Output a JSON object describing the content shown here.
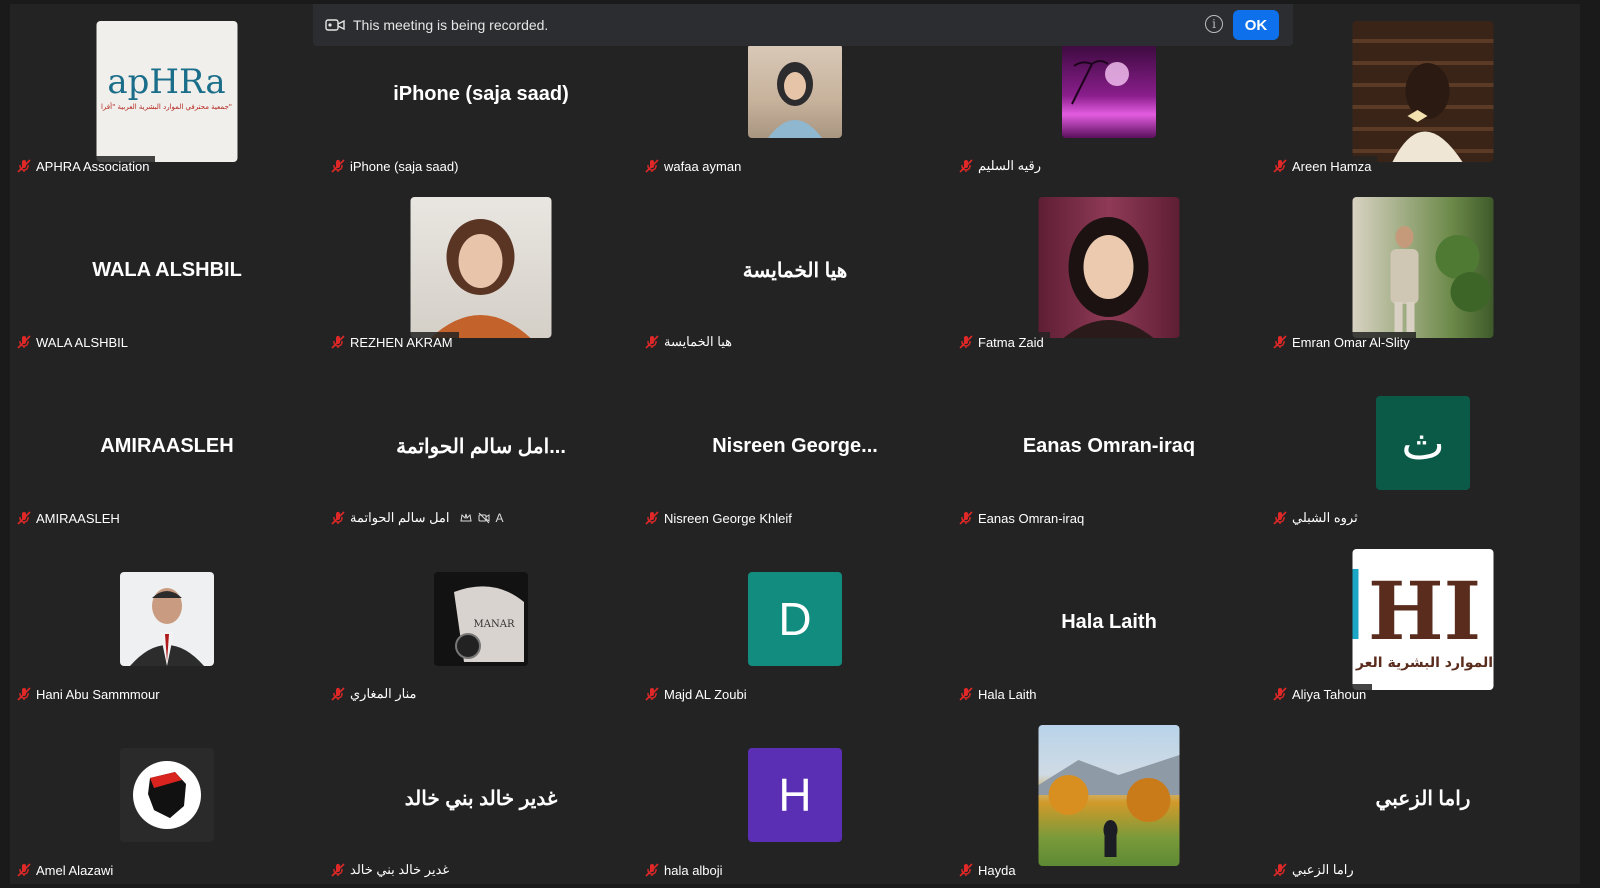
{
  "banner": {
    "text": "This meeting is being recorded.",
    "ok_label": "OK"
  },
  "tiles": [
    {
      "label": "APHRA Association",
      "kind": "photo-lg",
      "logo_text": "apHRa",
      "logo_sub": "جمعية محترفي الموارد البشرية العربية \"أفرا\""
    },
    {
      "label": "iPhone (saja saad)",
      "kind": "name",
      "display": "iPhone (saja saad)"
    },
    {
      "label": "wafaa ayman",
      "kind": "photo-sm",
      "scene": "woman-hijab"
    },
    {
      "label": "رقيه السليم",
      "kind": "photo-sm",
      "scene": "purple-night"
    },
    {
      "label": "Areen Hamza",
      "kind": "photo-lg",
      "scene": "bookshelf"
    },
    {
      "label": "WALA ALSHBIL",
      "kind": "name",
      "display": "WALA ALSHBIL"
    },
    {
      "label": "REZHEN AKRAM",
      "kind": "photo-lg",
      "scene": "woman-portrait"
    },
    {
      "label": "هيا الخمايسة",
      "kind": "name",
      "display": "هيا الخمايسة"
    },
    {
      "label": "Fatma Zaid",
      "kind": "photo-lg",
      "scene": "woman-smile"
    },
    {
      "label": "Emran Omar Al-Slity",
      "kind": "photo-lg",
      "scene": "man-plants"
    },
    {
      "label": "AMIRAASLEH",
      "kind": "name",
      "display": "AMIRAASLEH"
    },
    {
      "label": "امل سالم الحواتمة",
      "kind": "name",
      "display": "امل سالم الحواتمة...",
      "extra_letter": "A"
    },
    {
      "label": "Nisreen  George Khleif",
      "kind": "name",
      "display": "Nisreen  George..."
    },
    {
      "label": "Eanas Omran-iraq",
      "kind": "name",
      "display": "Eanas Omran-iraq"
    },
    {
      "label": "ثروه الشبلي",
      "kind": "letter",
      "letter": "ث",
      "color": "#0b5a48"
    },
    {
      "label": "Hani Abu Sammmour",
      "kind": "photo-sm",
      "scene": "man-suit"
    },
    {
      "label": "منار المغاري",
      "kind": "photo-sm",
      "scene": "hand-tattoo",
      "tattoo_text": "MANAR"
    },
    {
      "label": "Majd AL Zoubi",
      "kind": "letter",
      "letter": "D",
      "color": "#128c7e"
    },
    {
      "label": "Hala Laith",
      "kind": "name",
      "display": "Hala Laith"
    },
    {
      "label": "Aliya Tahoun",
      "kind": "photo-lg",
      "scene": "hr-logo",
      "logo_big": "HI",
      "logo_sub": "الموارد البشرية العر"
    },
    {
      "label": "Amel Alazawi",
      "kind": "photo-sm",
      "scene": "iraq-map"
    },
    {
      "label": "غدير خالد بني خالد",
      "kind": "name",
      "display": "غدير خالد بني خالد"
    },
    {
      "label": "hala alboji",
      "kind": "letter",
      "letter": "H",
      "color": "#5b2fb4"
    },
    {
      "label": "Hayda",
      "kind": "photo-lg",
      "scene": "autumn"
    },
    {
      "label": "راما الزعبي",
      "kind": "name",
      "display": "راما الزعبي"
    }
  ]
}
